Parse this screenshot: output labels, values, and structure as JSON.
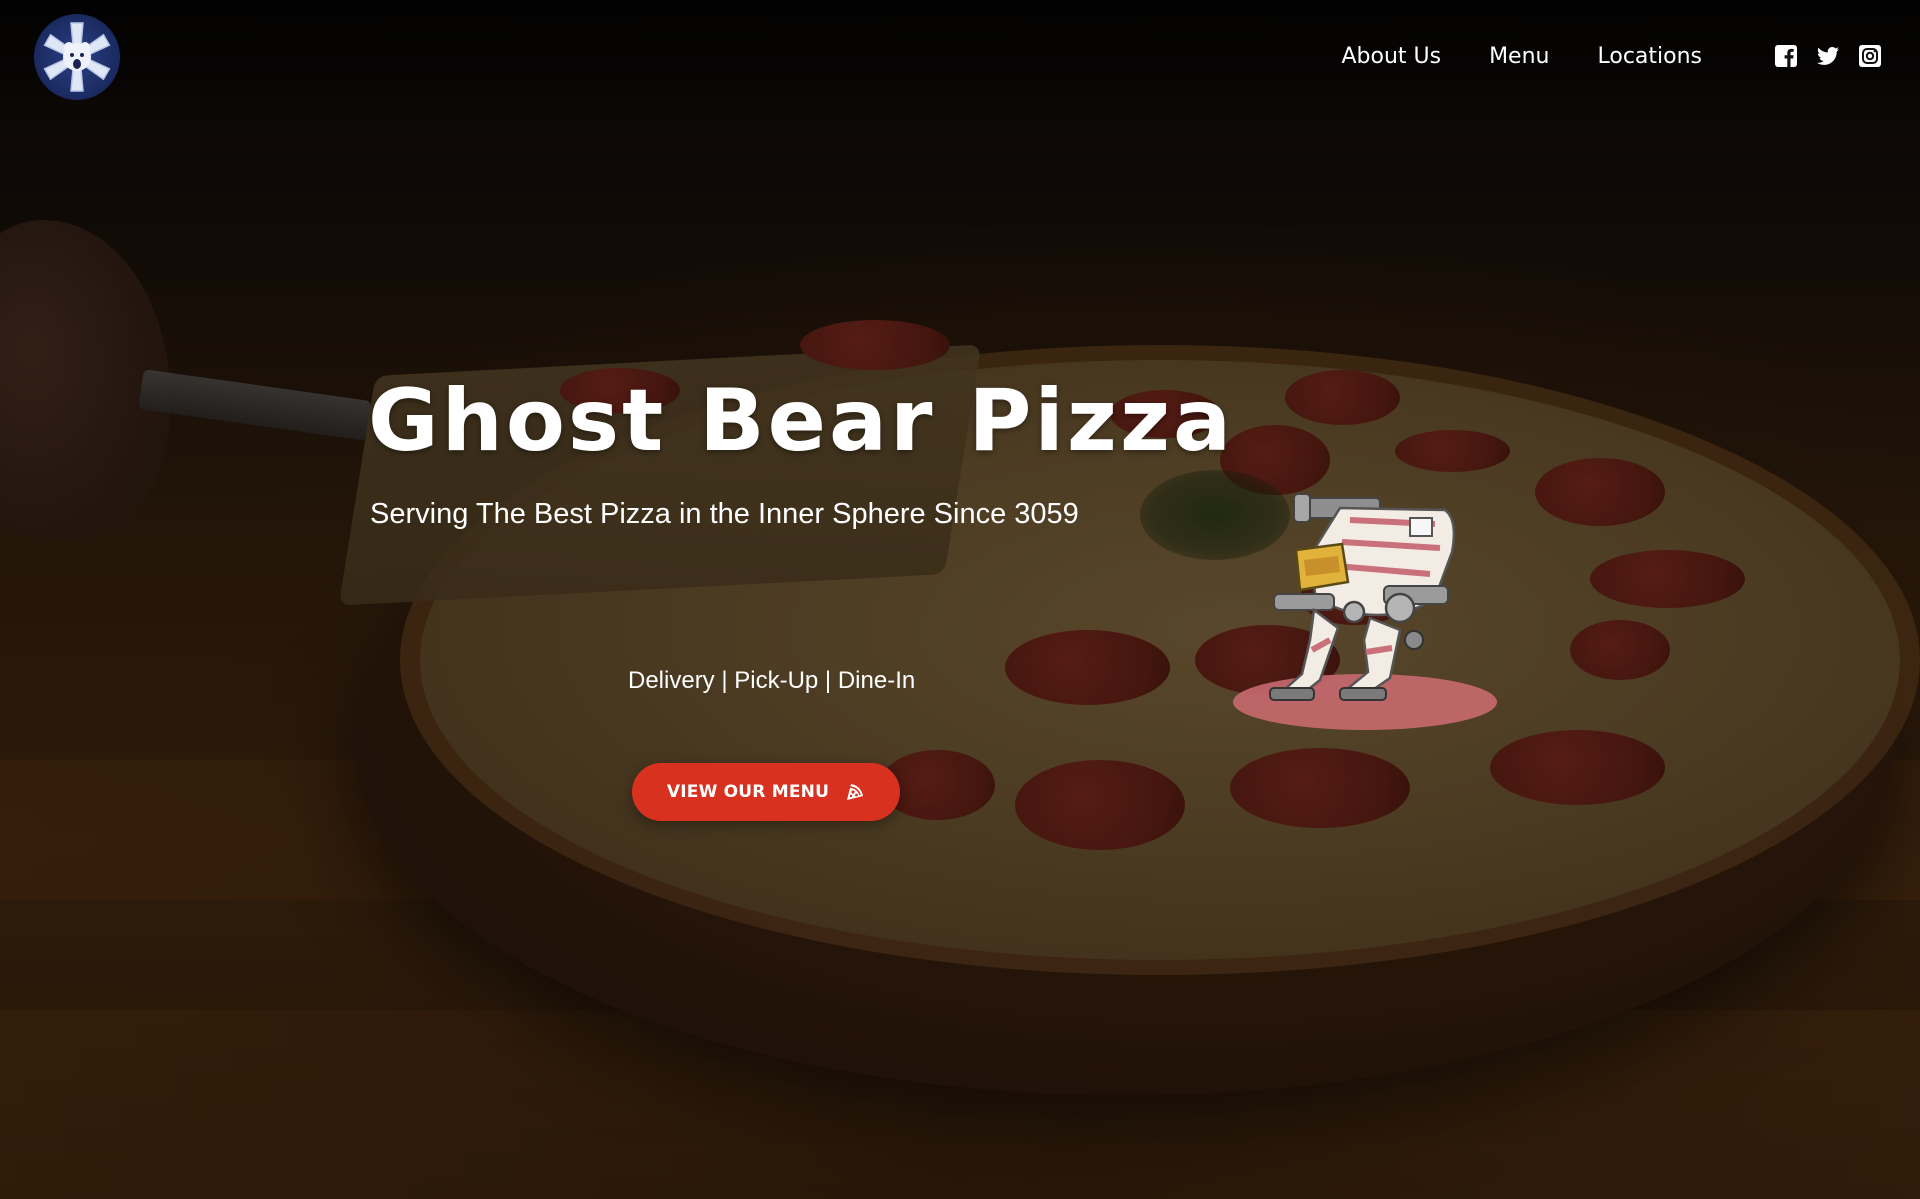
{
  "header": {
    "logo_icon": "ghost-bear-logo-icon",
    "nav": [
      {
        "label": "About Us"
      },
      {
        "label": "Menu"
      },
      {
        "label": "Locations"
      }
    ],
    "social": [
      {
        "icon": "facebook-icon"
      },
      {
        "icon": "twitter-icon"
      },
      {
        "icon": "instagram-icon"
      }
    ]
  },
  "hero": {
    "title": "Ghost Bear Pizza",
    "subtitle": "Serving The Best Pizza in the Inner Sphere Since 3059",
    "services": "Delivery | Pick-Up | Dine-In",
    "cta_label": "VIEW OUR MENU",
    "cta_icon": "pizza-slice-icon",
    "illustration": "mech-robot-illustration"
  },
  "colors": {
    "accent": "#d8311f",
    "text": "#ffffff",
    "logo_blue": "#2b3f83"
  }
}
